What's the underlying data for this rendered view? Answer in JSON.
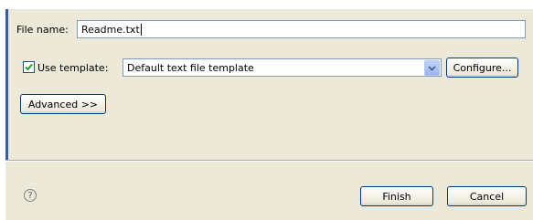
{
  "file_name": {
    "label": "File name:",
    "value": "Readme.txt"
  },
  "use_template": {
    "label": "Use template:",
    "checked": true
  },
  "template_select": {
    "value": "Default text file template"
  },
  "buttons": {
    "configure": "Configure...",
    "advanced": "Advanced >>",
    "finish": "Finish",
    "cancel": "Cancel"
  },
  "help_icon": "?"
}
